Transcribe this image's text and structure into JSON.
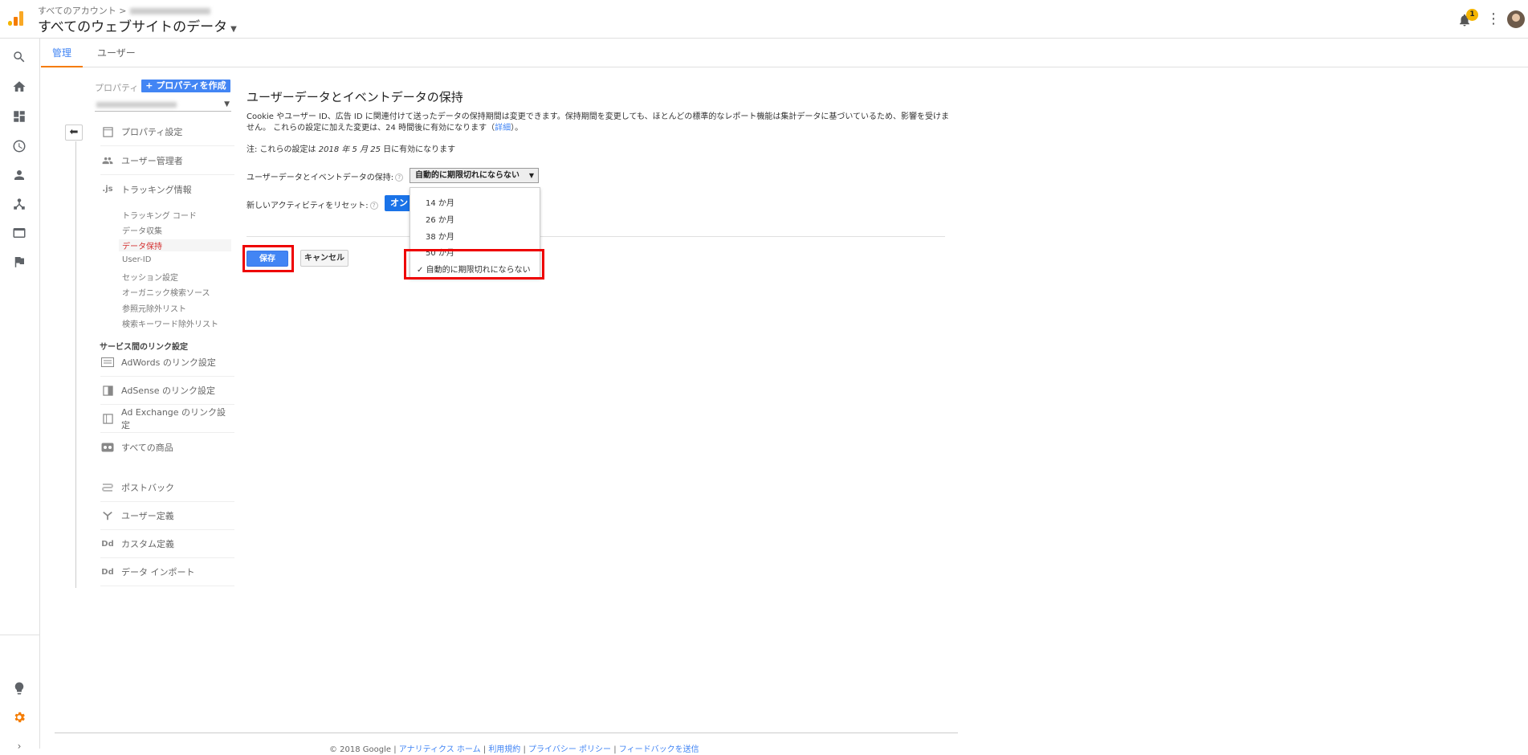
{
  "header": {
    "breadcrumb": "すべてのアカウント >",
    "view_title": "すべてのウェブサイトのデータ",
    "notification_count": "1"
  },
  "tabs": [
    {
      "label": "管理"
    },
    {
      "label": "ユーザー"
    }
  ],
  "property_panel": {
    "label": "プロパティ",
    "create_button": "+ プロパティを作成",
    "menu": [
      {
        "label": "プロパティ設定",
        "icon": "property-settings-icon"
      },
      {
        "label": "ユーザー管理者",
        "icon": "users-icon"
      },
      {
        "label": "トラッキング情報",
        "icon": "js-icon"
      }
    ],
    "tracking_sub": [
      "トラッキング コード",
      "データ収集",
      "データ保持",
      "User-ID",
      "セッション設定",
      "オーガニック検索ソース",
      "参照元除外リスト",
      "検索キーワード除外リスト"
    ],
    "service_link_heading": "サービス間のリンク設定",
    "service_links": [
      {
        "label": "AdWords のリンク設定",
        "icon": "adwords-icon"
      },
      {
        "label": "AdSense のリンク設定",
        "icon": "adsense-icon"
      },
      {
        "label": "Ad Exchange のリンク設定",
        "icon": "adexchange-icon"
      },
      {
        "label": "すべての商品",
        "icon": "all-products-icon"
      }
    ],
    "other": [
      {
        "label": "ポストバック",
        "icon": "postback-icon"
      },
      {
        "label": "ユーザー定義",
        "icon": "user-definition-icon"
      },
      {
        "label": "カスタム定義",
        "icon": "custom-definition-icon"
      },
      {
        "label": "データ インポート",
        "icon": "data-import-icon"
      }
    ]
  },
  "main": {
    "title": "ユーザーデータとイベントデータの保持",
    "desc_line1": "Cookie やユーザー ID、広告 ID に関連付けて送ったデータの保持期間は変更できます。保持期間を変更しても、ほとんどの標準的なレポート機能は集計データに基づいているため、影響を受けま",
    "desc_line2": "せん。 これらの設定に加えた変更は、24 時間後に有効になります（",
    "desc_link": "詳細",
    "desc_end": "）。",
    "note_prefix": "注: これらの設定は ",
    "note_date": "2018 年 5 月 25",
    "note_suffix": " 日に有効になります",
    "retention_label": "ユーザーデータとイベントデータの保持:",
    "retention_value": "自動的に期限切れにならない",
    "reset_label": "新しいアクティビティをリセット:",
    "reset_button": "オン",
    "save": "保存",
    "cancel": "キャンセル",
    "dropdown_options": [
      "14 か月",
      "26 か月",
      "38 か月",
      "50 か月",
      "自動的に期限切れにならない"
    ],
    "checked_mark": "✓"
  },
  "footer": {
    "copyright": "© 2018 Google | ",
    "links": [
      "アナリティクス ホーム",
      "利用規約",
      "プライバシー ポリシー",
      "フィードバックを送信"
    ]
  },
  "colors": {
    "accent": "#4285f4",
    "highlight": "#ee0000",
    "active_tab_underline": "#f57c00"
  }
}
